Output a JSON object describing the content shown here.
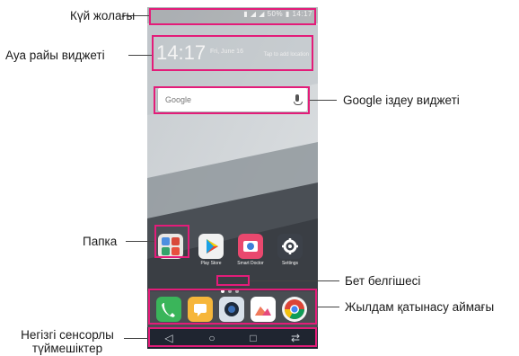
{
  "labels": {
    "status_bar": "Күй жолағы",
    "weather_widget": "Ауа райы виджеті",
    "google_search_widget": "Google іздеу виджеті",
    "folder": "Папка",
    "page_indicator": "Бет белгішесі",
    "quick_access_area": "Жылдам қатынасу аймағы",
    "home_touch_buttons_line1": "Негізгі сенсорлы",
    "home_touch_buttons_line2": "түймешіктер"
  },
  "phone": {
    "status_text": "▮ ◢ ◢ 50% ▮ 14:17",
    "clock": "14:17",
    "date": "Fri, June 16",
    "weather_location": "",
    "weather_tap": "Tap to add location",
    "google_logo": "Google",
    "apps": [
      "",
      "Play Store",
      "Smart Doctor",
      "Settings"
    ],
    "dock_icons": [
      "phone-icon",
      "messages-icon",
      "camera-icon",
      "gallery-icon",
      "chrome-icon"
    ],
    "nav_icons": {
      "back": "◁",
      "home": "○",
      "recents": "□",
      "dual": "⇄"
    }
  },
  "colors": {
    "highlight": "#e31c79"
  }
}
